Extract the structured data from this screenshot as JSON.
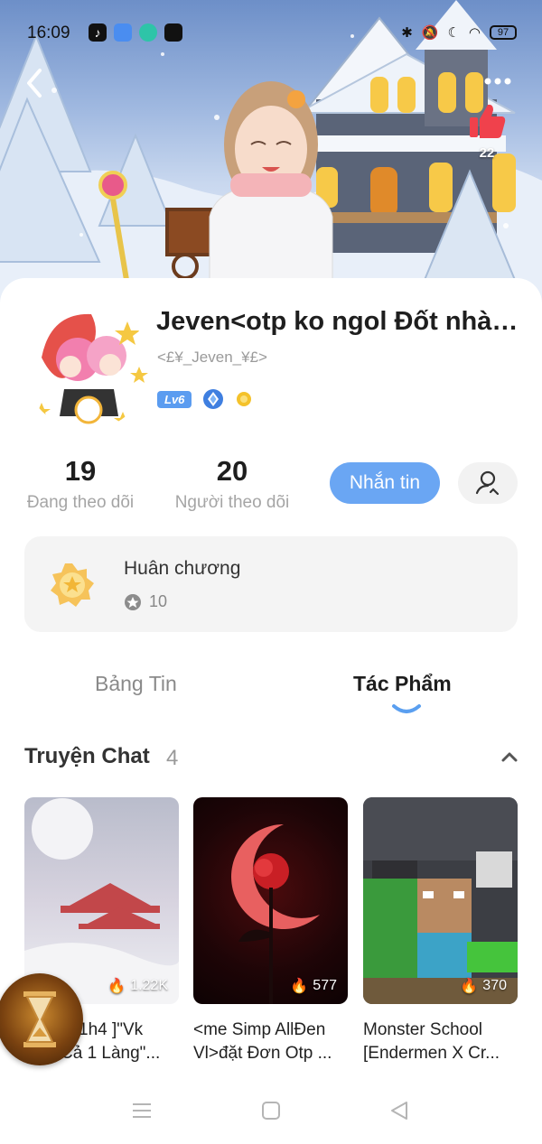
{
  "status_bar": {
    "time": "16:09",
    "battery": "97",
    "apps": [
      "tiktok-icon",
      "novel-toon-icon",
      "chat-app-icon",
      "video-app-icon"
    ],
    "system_icons": [
      "bluetooth-icon",
      "mute-icon",
      "do-not-disturb-icon",
      "wifi-icon",
      "battery-icon"
    ]
  },
  "header": {
    "like_count": "22"
  },
  "profile": {
    "name": "Jeven<otp ko ngol Đốt nhà t...",
    "handle": "<£¥_Jeven_¥£>",
    "level": "Lv6",
    "badges": [
      "level-badge",
      "diamond-badge-icon",
      "gold-coin-badge-icon"
    ]
  },
  "stats": {
    "following_count": "19",
    "following_label": "Đang theo dõi",
    "followers_count": "20",
    "followers_label": "Người theo dõi"
  },
  "actions": {
    "message_label": "Nhắn tin"
  },
  "medals": {
    "title": "Huân chương",
    "count": "10"
  },
  "tabs": {
    "feed": "Bảng Tin",
    "works": "Tác Phẩm",
    "active": "works"
  },
  "section": {
    "title": "Truyện Chat",
    "count": "4"
  },
  "stories": [
    {
      "views": "1.22K",
      "line1": "1h4 ]\"Vk",
      "line2": "Cả 1 Làng\"..."
    },
    {
      "views": "577",
      "line1": "<me Simp AllĐen",
      "line2": "Vl>đặt Đơn Otp ..."
    },
    {
      "views": "370",
      "line1": "Monster School",
      "line2": "[Endermen X Cr..."
    }
  ],
  "colors": {
    "accent": "#6aa6f3",
    "level_badge": "#5b9cf0",
    "like": "#f0414c",
    "tab_indicator": "#5a9ff0"
  }
}
